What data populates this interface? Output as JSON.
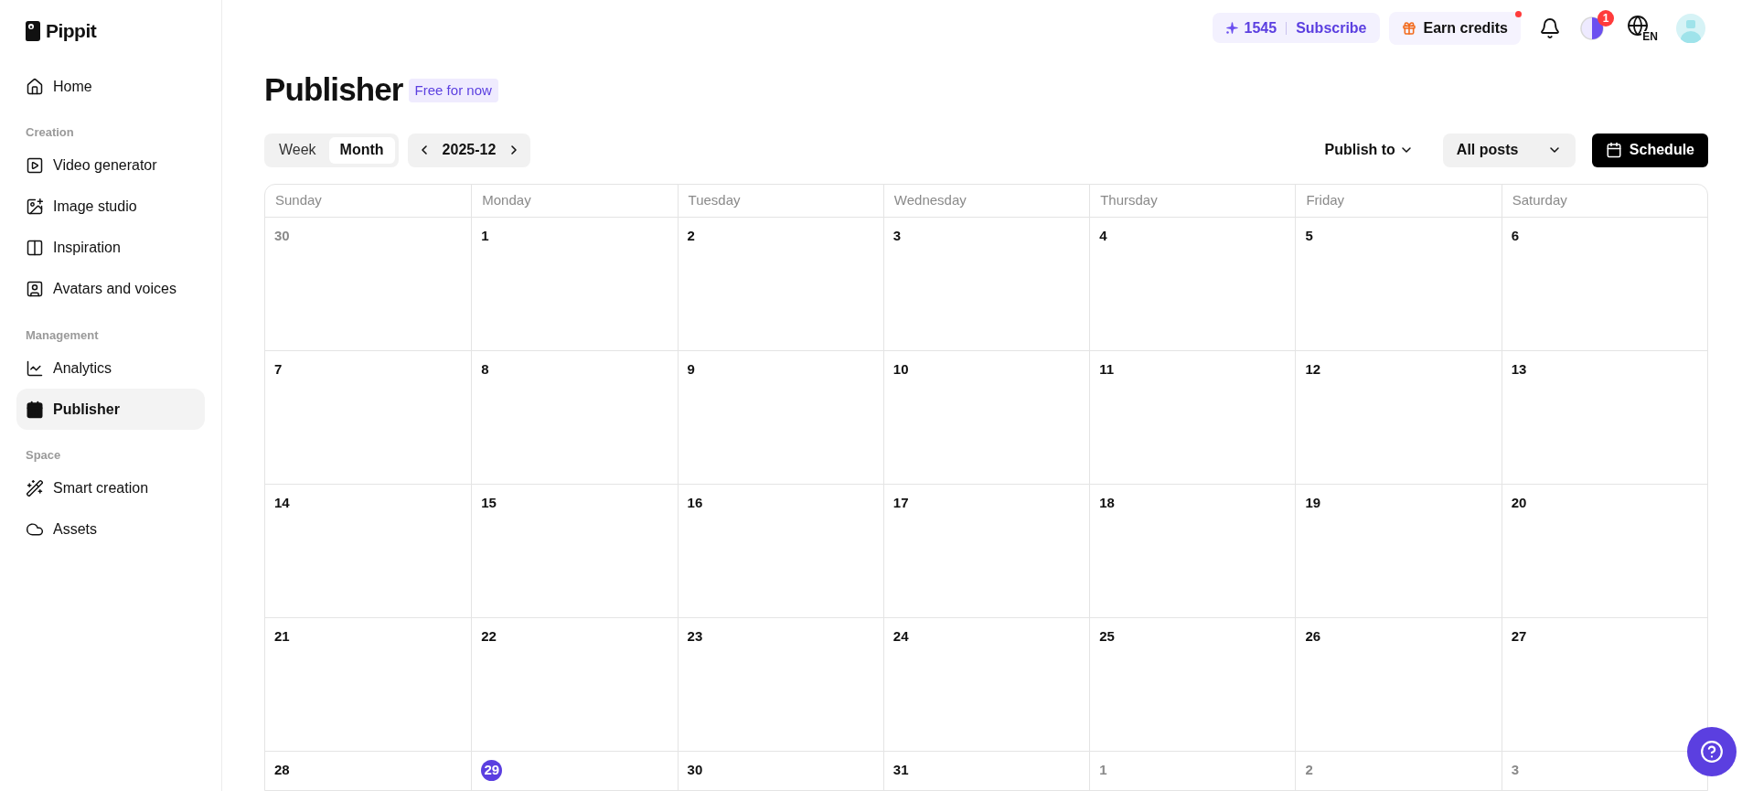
{
  "sidebar": {
    "logo": "Pippit",
    "sections": [
      {
        "items": [
          {
            "label": "Home",
            "selected": false
          }
        ]
      },
      {
        "title": "Creation",
        "items": [
          {
            "label": "Video generator",
            "selected": false
          },
          {
            "label": "Image studio",
            "selected": false
          },
          {
            "label": "Inspiration",
            "selected": false
          },
          {
            "label": "Avatars and voices",
            "selected": false
          }
        ]
      },
      {
        "title": "Management",
        "items": [
          {
            "label": "Analytics",
            "selected": false
          },
          {
            "label": "Publisher",
            "selected": true
          }
        ]
      },
      {
        "title": "Space",
        "items": [
          {
            "label": "Smart creation",
            "selected": false
          },
          {
            "label": "Assets",
            "selected": false
          }
        ]
      }
    ]
  },
  "topbar": {
    "credits": "1545",
    "subscribe": "Subscribe",
    "earn_credits": "Earn credits",
    "earn_dot": true,
    "theme_badge": "1",
    "language": "EN"
  },
  "page": {
    "title": "Publisher",
    "badge": "Free for now"
  },
  "toolbar": {
    "views": [
      {
        "label": "Week",
        "selected": false
      },
      {
        "label": "Month",
        "selected": true
      }
    ],
    "period": "2025-12",
    "publish_to": "Publish to",
    "filter": "All posts",
    "schedule": "Schedule"
  },
  "calendar": {
    "weekdays": [
      "Sunday",
      "Monday",
      "Tuesday",
      "Wednesday",
      "Thursday",
      "Friday",
      "Saturday"
    ],
    "weeks": [
      [
        {
          "day": "30",
          "outside": true,
          "today": false
        },
        {
          "day": "1",
          "outside": false,
          "today": false
        },
        {
          "day": "2",
          "outside": false,
          "today": false
        },
        {
          "day": "3",
          "outside": false,
          "today": false
        },
        {
          "day": "4",
          "outside": false,
          "today": false
        },
        {
          "day": "5",
          "outside": false,
          "today": false
        },
        {
          "day": "6",
          "outside": false,
          "today": false
        }
      ],
      [
        {
          "day": "7",
          "outside": false,
          "today": false
        },
        {
          "day": "8",
          "outside": false,
          "today": false
        },
        {
          "day": "9",
          "outside": false,
          "today": false
        },
        {
          "day": "10",
          "outside": false,
          "today": false
        },
        {
          "day": "11",
          "outside": false,
          "today": false
        },
        {
          "day": "12",
          "outside": false,
          "today": false
        },
        {
          "day": "13",
          "outside": false,
          "today": false
        }
      ],
      [
        {
          "day": "14",
          "outside": false,
          "today": false
        },
        {
          "day": "15",
          "outside": false,
          "today": false
        },
        {
          "day": "16",
          "outside": false,
          "today": false
        },
        {
          "day": "17",
          "outside": false,
          "today": false
        },
        {
          "day": "18",
          "outside": false,
          "today": false
        },
        {
          "day": "19",
          "outside": false,
          "today": false
        },
        {
          "day": "20",
          "outside": false,
          "today": false
        }
      ],
      [
        {
          "day": "21",
          "outside": false,
          "today": false
        },
        {
          "day": "22",
          "outside": false,
          "today": false
        },
        {
          "day": "23",
          "outside": false,
          "today": false
        },
        {
          "day": "24",
          "outside": false,
          "today": false
        },
        {
          "day": "25",
          "outside": false,
          "today": false
        },
        {
          "day": "26",
          "outside": false,
          "today": false
        },
        {
          "day": "27",
          "outside": false,
          "today": false
        }
      ],
      [
        {
          "day": "28",
          "outside": false,
          "today": false
        },
        {
          "day": "29",
          "outside": false,
          "today": true
        },
        {
          "day": "30",
          "outside": false,
          "today": false
        },
        {
          "day": "31",
          "outside": false,
          "today": false
        },
        {
          "day": "1",
          "outside": true,
          "today": false
        },
        {
          "day": "2",
          "outside": true,
          "today": false
        },
        {
          "day": "3",
          "outside": true,
          "today": false
        }
      ]
    ]
  }
}
